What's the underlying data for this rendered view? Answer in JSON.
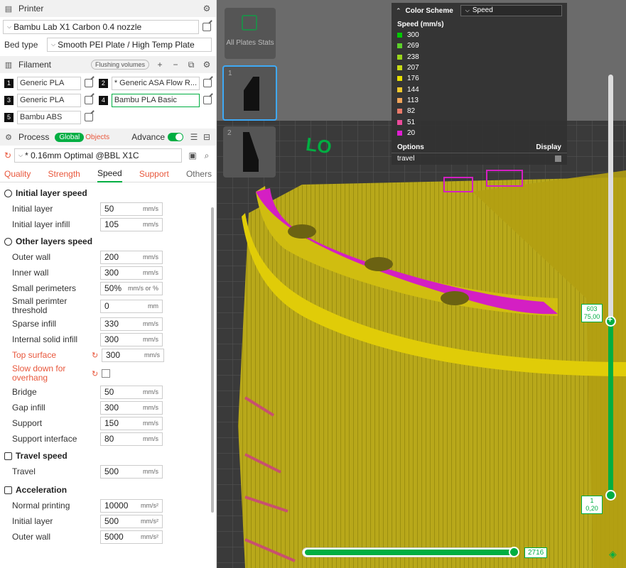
{
  "printer": {
    "title": "Printer",
    "name": "Bambu Lab X1 Carbon 0.4 nozzle",
    "bed_type_label": "Bed type",
    "bed_type": "Smooth PEI Plate / High Temp Plate"
  },
  "filament": {
    "title": "Filament",
    "flushing_label": "Flushing volumes",
    "items": [
      {
        "num": "1",
        "name": "Generic PLA"
      },
      {
        "num": "2",
        "name": "* Generic ASA Flow R..."
      },
      {
        "num": "3",
        "name": "Generic PLA"
      },
      {
        "num": "4",
        "name": "Bambu PLA Basic"
      },
      {
        "num": "5",
        "name": "Bambu ABS"
      }
    ]
  },
  "process": {
    "title": "Process",
    "global_label": "Global",
    "objects_label": "Objects",
    "advance_label": "Advance",
    "profile": "* 0.16mm Optimal @BBL X1C",
    "tabs": [
      "Quality",
      "Strength",
      "Speed",
      "Support",
      "Others"
    ],
    "groups": {
      "initial": "Initial layer speed",
      "other": "Other layers speed",
      "travel": "Travel speed",
      "accel": "Acceleration"
    },
    "params": {
      "initial_layer": {
        "label": "Initial layer",
        "value": "50",
        "unit": "mm/s"
      },
      "initial_layer_infill": {
        "label": "Initial layer infill",
        "value": "105",
        "unit": "mm/s"
      },
      "outer_wall": {
        "label": "Outer wall",
        "value": "200",
        "unit": "mm/s"
      },
      "inner_wall": {
        "label": "Inner wall",
        "value": "300",
        "unit": "mm/s"
      },
      "small_perimeters": {
        "label": "Small perimeters",
        "value": "50%",
        "unit": "mm/s or %"
      },
      "small_perimeter_threshold": {
        "label": "Small perimter threshold",
        "value": "0",
        "unit": "mm"
      },
      "sparse_infill": {
        "label": "Sparse infill",
        "value": "330",
        "unit": "mm/s"
      },
      "internal_solid_infill": {
        "label": "Internal solid infill",
        "value": "300",
        "unit": "mm/s"
      },
      "top_surface": {
        "label": "Top surface",
        "value": "300",
        "unit": "mm/s"
      },
      "slow_down_overhang": {
        "label": "Slow down for overhang"
      },
      "bridge": {
        "label": "Bridge",
        "value": "50",
        "unit": "mm/s"
      },
      "gap_infill": {
        "label": "Gap infill",
        "value": "300",
        "unit": "mm/s"
      },
      "support": {
        "label": "Support",
        "value": "150",
        "unit": "mm/s"
      },
      "support_interface": {
        "label": "Support interface",
        "value": "80",
        "unit": "mm/s"
      },
      "travel": {
        "label": "Travel",
        "value": "500",
        "unit": "mm/s"
      },
      "normal_printing": {
        "label": "Normal printing",
        "value": "10000",
        "unit": "mm/s²"
      },
      "accel_initial_layer": {
        "label": "Initial layer",
        "value": "500",
        "unit": "mm/s²"
      },
      "accel_outer_wall": {
        "label": "Outer wall",
        "value": "5000",
        "unit": "mm/s²"
      }
    }
  },
  "legend": {
    "title": "Color Scheme",
    "scheme": "Speed",
    "unit_label": "Speed (mm/s)",
    "items": [
      {
        "value": "300",
        "color": "#00c800"
      },
      {
        "value": "269",
        "color": "#5cd12b"
      },
      {
        "value": "238",
        "color": "#9ad61b"
      },
      {
        "value": "207",
        "color": "#c8dc17"
      },
      {
        "value": "176",
        "color": "#e8e000"
      },
      {
        "value": "144",
        "color": "#f0c82c"
      },
      {
        "value": "113",
        "color": "#f0a55a"
      },
      {
        "value": "82",
        "color": "#ec7a6a"
      },
      {
        "value": "51",
        "color": "#ec4b9a"
      },
      {
        "value": "20",
        "color": "#e01ed2"
      }
    ],
    "options_label": "Options",
    "display_label": "Display",
    "travel_label": "travel"
  },
  "plates": {
    "all_plates": "All Plates Stats",
    "plate1": "1",
    "plate2": "2"
  },
  "layers": {
    "top_layer": "603",
    "top_height": "75,00",
    "bottom_layer": "1",
    "bottom_height": "0,20",
    "move_value": "2716"
  },
  "colors": {
    "accent": "#00ae42",
    "modified": "#e8573c",
    "model_yellow": "#c9b400",
    "overhang_magenta": "#d41fc3"
  }
}
